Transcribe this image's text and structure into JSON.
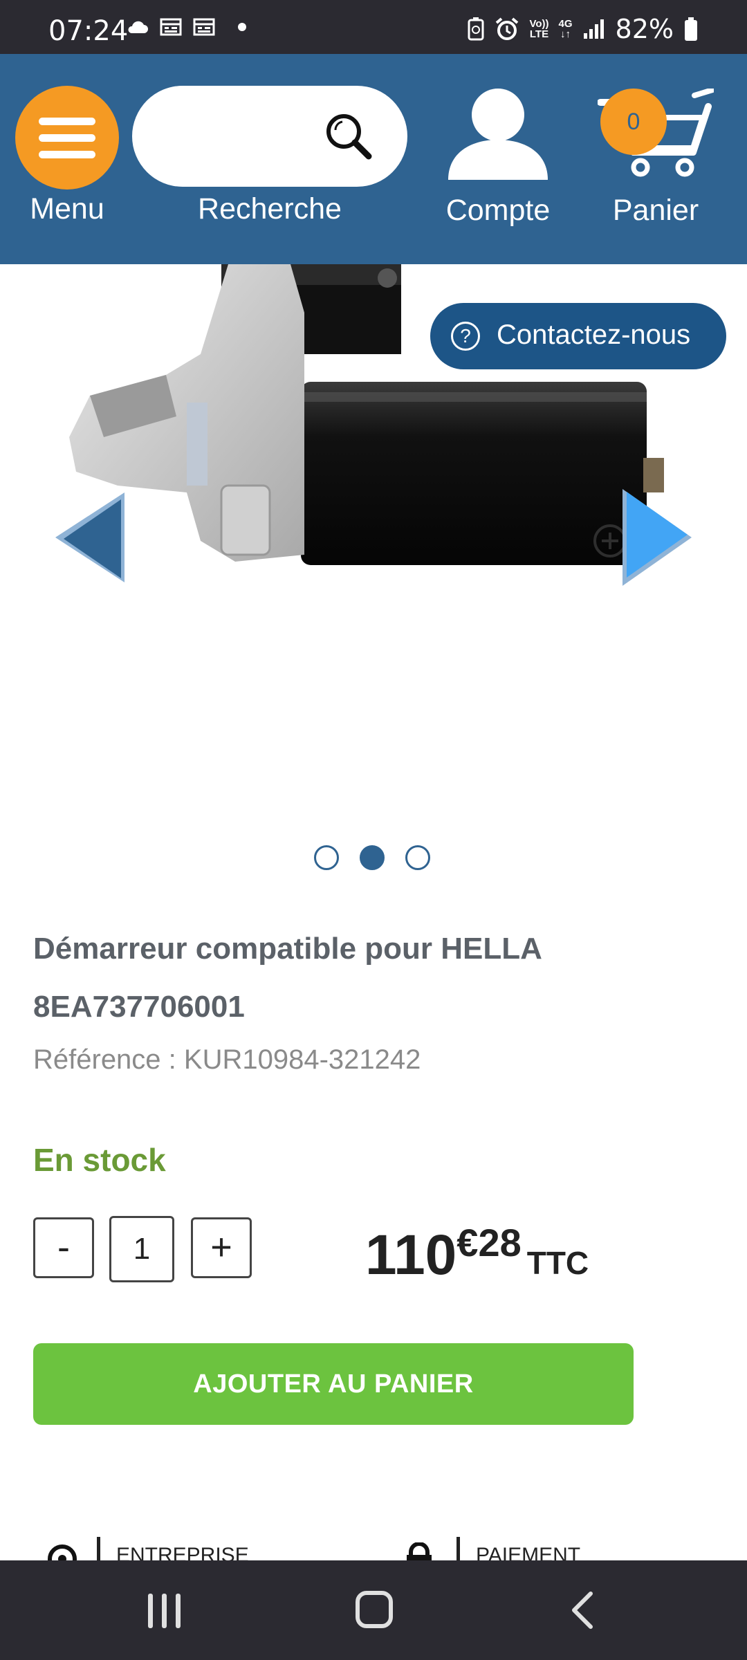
{
  "status_bar": {
    "time": "07:24",
    "battery": "82%",
    "network_top": "4G",
    "volte_line1": "Vo))",
    "volte_line2": "LTE"
  },
  "header": {
    "menu_label": "Menu",
    "search_label": "Recherche",
    "search_placeholder": "",
    "account_label": "Compte",
    "cart_label": "Panier",
    "cart_count": "0"
  },
  "gallery": {
    "contact_label": "Contactez-nous",
    "contact_icon": "?",
    "slides": 3,
    "active_slide": 2
  },
  "product": {
    "title": "Démarreur compatible pour HELLA 8EA737706001",
    "reference": "Référence : KUR10984-321242",
    "stock": "En stock",
    "qty_minus": "-",
    "qty_plus": "+",
    "quantity": "1",
    "price_int": "110",
    "price_cents": "€28",
    "price_suffix": "TTC",
    "add_to_cart": "AJOUTER AU PANIER"
  },
  "footer_peek": {
    "left_label": "ENTREPRISE",
    "right_label": "PAIEMENT"
  },
  "colors": {
    "header_blue": "#2f6391",
    "accent_orange": "#f59a23",
    "contact_blue": "#1d5587",
    "stock_green": "#6a9a36",
    "cart_button_green": "#6cc33f",
    "arrow_light_blue": "#42a5f5"
  }
}
